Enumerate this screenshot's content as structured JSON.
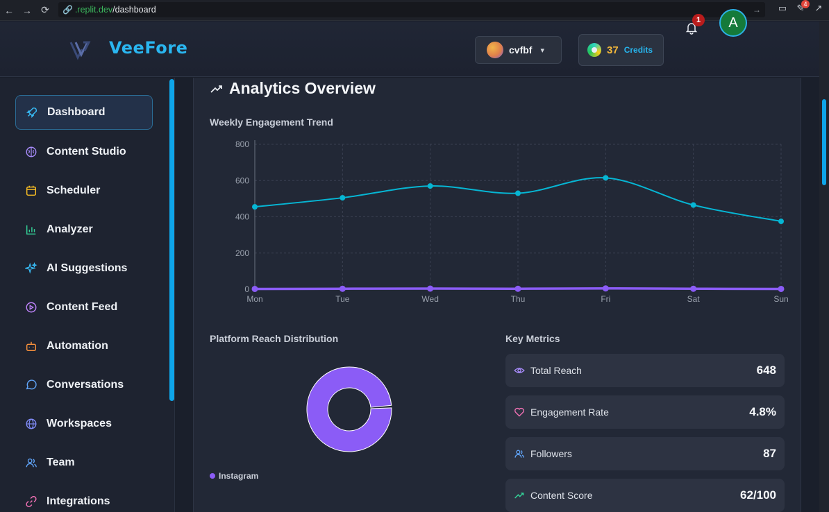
{
  "browser": {
    "url_host": ".replit.dev",
    "url_path": "/dashboard",
    "extension_badge": "4"
  },
  "header": {
    "brand": "VeeFore",
    "workspace_name": "cvfbf",
    "credits_value": "37",
    "credits_label": "Credits",
    "notification_count": "1",
    "avatar_initial": "A"
  },
  "sidebar": {
    "items": [
      {
        "label": "Dashboard",
        "icon": "rocket-icon",
        "active": true
      },
      {
        "label": "Content Studio",
        "icon": "brain-icon"
      },
      {
        "label": "Scheduler",
        "icon": "calendar-icon"
      },
      {
        "label": "Analyzer",
        "icon": "bar-chart-icon"
      },
      {
        "label": "AI Suggestions",
        "icon": "sparkles-icon"
      },
      {
        "label": "Content Feed",
        "icon": "play-circle-icon"
      },
      {
        "label": "Automation",
        "icon": "bot-icon"
      },
      {
        "label": "Conversations",
        "icon": "message-circle-icon"
      },
      {
        "label": "Workspaces",
        "icon": "globe-icon"
      },
      {
        "label": "Team",
        "icon": "users-icon"
      },
      {
        "label": "Integrations",
        "icon": "link-icon"
      }
    ]
  },
  "main": {
    "title": "Analytics Overview",
    "trend_label": "Weekly Engagement Trend",
    "reach_label": "Platform Reach Distribution",
    "metrics_label": "Key Metrics",
    "legend_label": "Instagram",
    "metrics": [
      {
        "label": "Total Reach",
        "value": "648",
        "icon": "eye-icon",
        "color": "#a78bfa"
      },
      {
        "label": "Engagement Rate",
        "value": "4.8%",
        "icon": "heart-icon",
        "color": "#f472b6"
      },
      {
        "label": "Followers",
        "value": "87",
        "icon": "users-icon",
        "color": "#60a5fa"
      },
      {
        "label": "Content Score",
        "value": "62/100",
        "icon": "trending-up-icon",
        "color": "#34d399"
      }
    ]
  },
  "chart_data": [
    {
      "type": "line",
      "title": "Weekly Engagement Trend",
      "categories": [
        "Mon",
        "Tue",
        "Wed",
        "Thu",
        "Fri",
        "Sat",
        "Sun"
      ],
      "yticks": [
        0,
        200,
        400,
        600,
        800
      ],
      "ylim": [
        0,
        800
      ],
      "grid": true,
      "series": [
        {
          "values": [
            455,
            505,
            570,
            530,
            615,
            465,
            375
          ],
          "color": "#06b6d4"
        },
        {
          "values": [
            2,
            3,
            4,
            3,
            5,
            3,
            2
          ],
          "color": "#8b5cf6"
        }
      ]
    },
    {
      "type": "pie",
      "title": "Platform Reach Distribution",
      "slices": [
        {
          "label": "Instagram",
          "value": 100,
          "color": "#8b5cf6"
        }
      ],
      "legend": "bottom-left"
    }
  ]
}
